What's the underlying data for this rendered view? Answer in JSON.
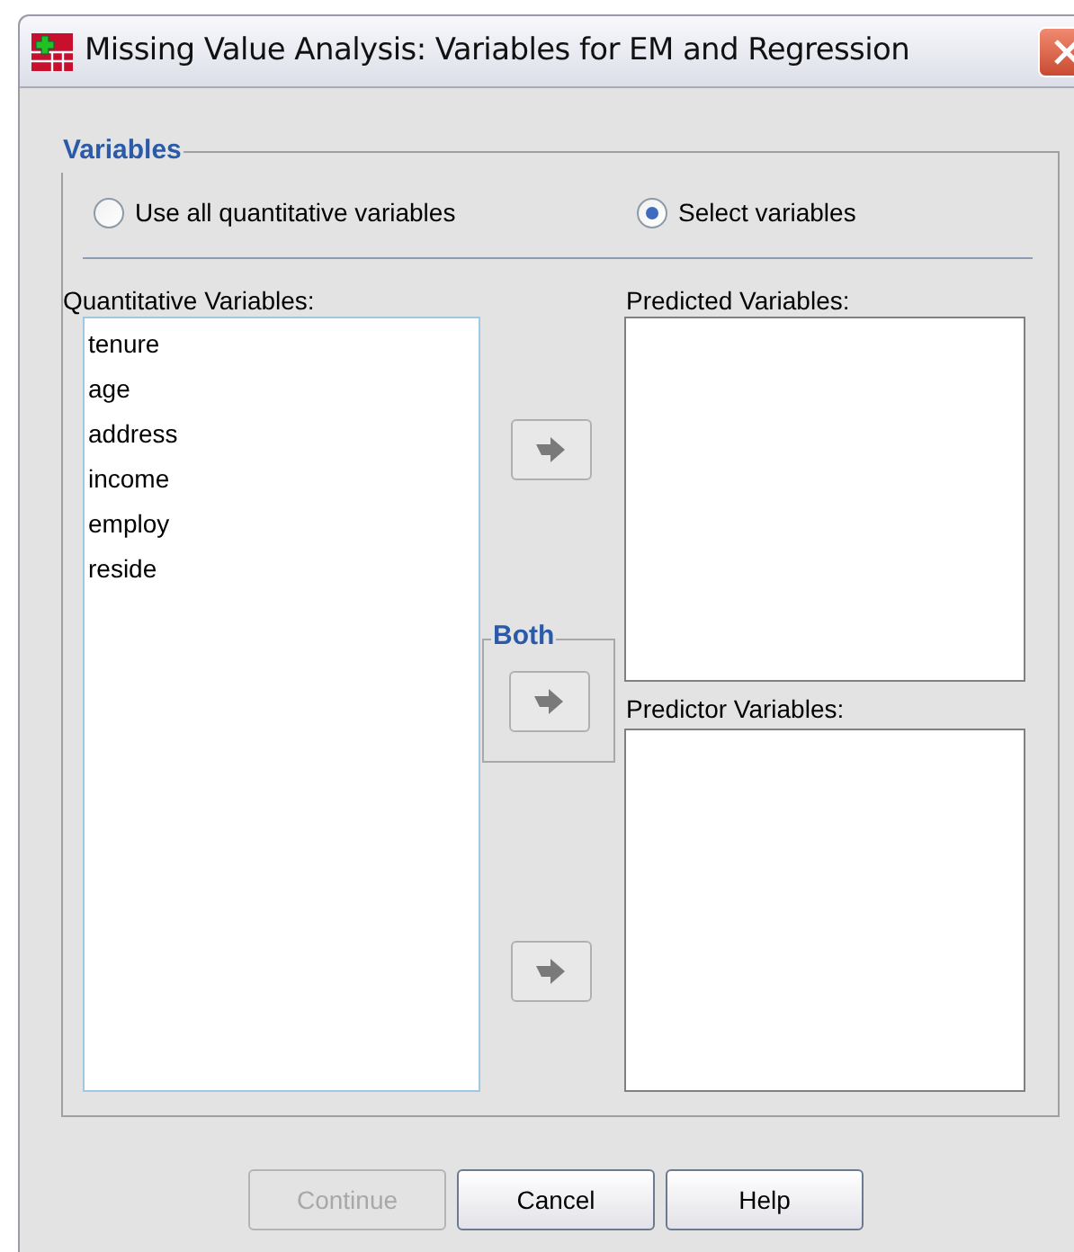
{
  "window": {
    "title": "Missing Value Analysis: Variables for EM and Regression"
  },
  "group": {
    "title": "Variables"
  },
  "radios": [
    {
      "label": "Use all quantitative variables",
      "selected": false
    },
    {
      "label": "Select variables",
      "selected": true
    }
  ],
  "source": {
    "label": "Quantitative Variables:",
    "items": [
      "tenure",
      "age",
      "address",
      "income",
      "employ",
      "reside"
    ]
  },
  "both_label": "Both",
  "predicted": {
    "label": "Predicted Variables:"
  },
  "predictor": {
    "label": "Predictor Variables:"
  },
  "buttons": [
    {
      "label": "Continue",
      "disabled": true
    },
    {
      "label": "Cancel",
      "disabled": false
    },
    {
      "label": "Help",
      "disabled": false
    }
  ]
}
